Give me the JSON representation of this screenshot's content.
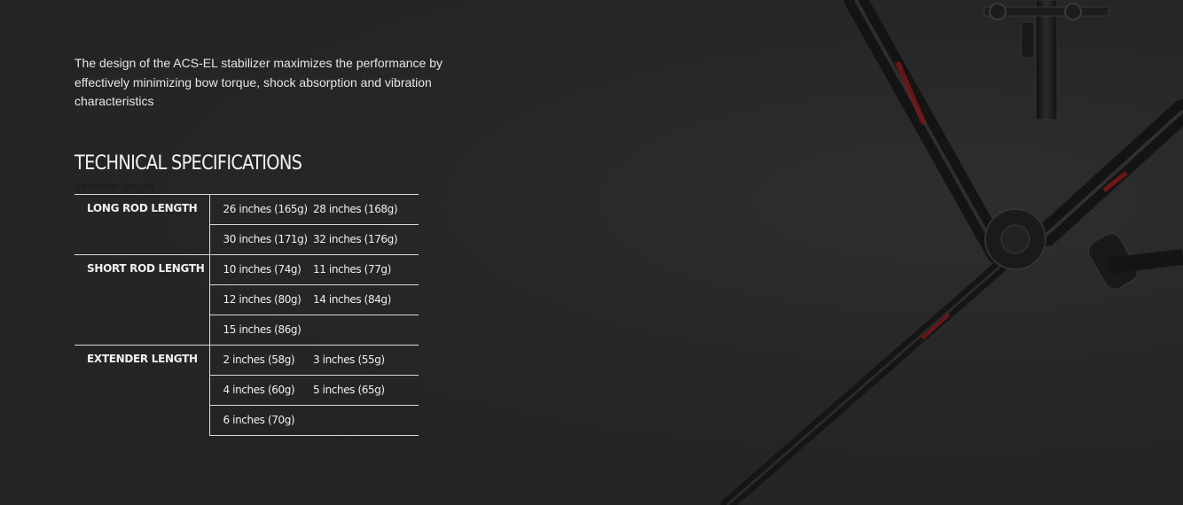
{
  "intro": {
    "text": "The design of the ACS-EL stabilizer maximizes the performance by effectively minimizing bow torque, shock absorption and vibration characteristics"
  },
  "specs": {
    "title": "TECHNICAL SPECIFICATIONS",
    "ghost_label": "extender length",
    "groups": [
      {
        "label": "LONG ROD LENGTH",
        "rows": [
          [
            "26 inches (165g)",
            "28 inches (168g)"
          ],
          [
            "30 inches (171g)",
            "32 inches (176g)"
          ]
        ]
      },
      {
        "label": "SHORT ROD LENGTH",
        "rows": [
          [
            "10 inches (74g)",
            "11 inches (77g)"
          ],
          [
            "12 inches (80g)",
            "14 inches (84g)"
          ],
          [
            "15 inches (86g)",
            ""
          ]
        ]
      },
      {
        "label": "EXTENDER LENGTH",
        "rows": [
          [
            "2 inches (58g)",
            "3 inches (55g)"
          ],
          [
            "4 inches (60g)",
            "5 inches (65g)"
          ],
          [
            "6 inches (70g)",
            ""
          ]
        ]
      }
    ]
  },
  "colors": {
    "background": "#262626",
    "text": "#e9e9e9",
    "rule": "#d9d9d9",
    "accent_red": "#8b1a1a"
  },
  "product_image": {
    "icon": "stabilizer-product-photo"
  }
}
